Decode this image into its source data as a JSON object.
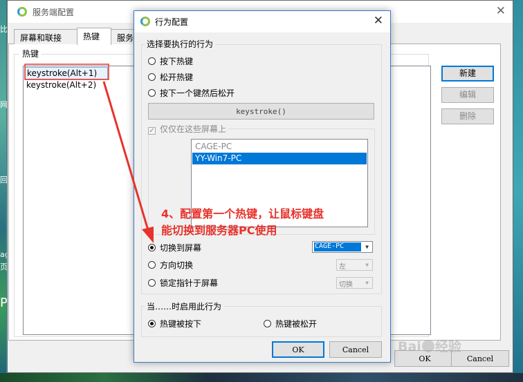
{
  "main_window": {
    "title": "服务端配置",
    "tabs": [
      {
        "label": "屏幕和联接"
      },
      {
        "label": "热键"
      },
      {
        "label": "服务端"
      }
    ],
    "group_label": "热键",
    "hotkeys": [
      "keystroke(Alt+1)",
      "keystroke(Alt+2)"
    ],
    "side_buttons": {
      "new": "新建",
      "edit": "编辑",
      "delete": "删除"
    },
    "ok_label": "OK",
    "cancel_label": "Cancel"
  },
  "dialog": {
    "title": "行为配置",
    "action_group_label": "选择要执行的行为",
    "actions": [
      "按下热键",
      "松开热键",
      "按下一个键然后松开"
    ],
    "selected_action": null,
    "keystroke_button": "keystroke()",
    "only_screens_label": "仅仅在这些屏幕上",
    "only_screens_checked": true,
    "screens": [
      "CAGE-PC",
      "YY-Win7-PC"
    ],
    "selected_screen": "YY-Win7-PC",
    "switch_options": [
      {
        "label": "切换到屏幕",
        "selected": true,
        "combo_value": "CAGE-PC",
        "combo_enabled": true
      },
      {
        "label": "方向切换",
        "selected": false,
        "combo_value": "左",
        "combo_enabled": false
      },
      {
        "label": "锁定指针于屏幕",
        "selected": false,
        "combo_value": "切换",
        "combo_enabled": false
      }
    ],
    "trigger_group_label": "当……时启用此行为",
    "triggers": [
      {
        "label": "热键被按下",
        "selected": true
      },
      {
        "label": "热键被松开",
        "selected": false
      }
    ],
    "ok_label": "OK",
    "cancel_label": "Cancel"
  },
  "annotation": {
    "line1": "4、配置第一个热键，让鼠标键盘",
    "line2": "能切换到服务器PC使用",
    "color": "#e8322b"
  },
  "watermark": {
    "text_left": "Bai",
    "text_right": "经验"
  },
  "desktop": {
    "edge_glyphs": [
      "比",
      "网",
      "回",
      "ag",
      "页",
      "P"
    ]
  }
}
